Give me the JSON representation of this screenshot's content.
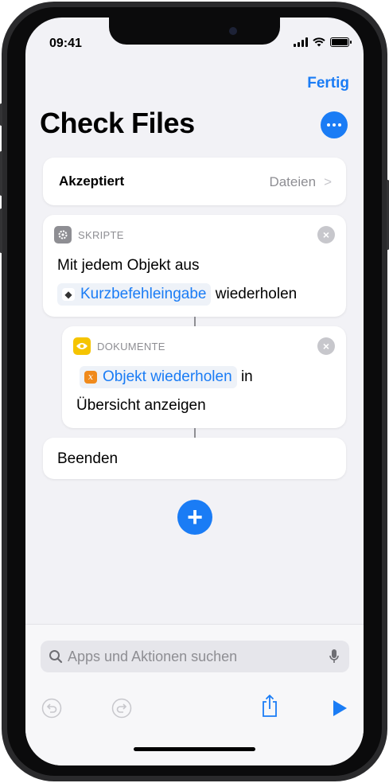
{
  "status": {
    "time": "09:41"
  },
  "nav": {
    "done_label": "Fertig"
  },
  "title": "Check Files",
  "accept": {
    "label": "Akzeptiert",
    "value": "Dateien"
  },
  "actions": [
    {
      "category": "SKRIPTE",
      "line1": "Mit jedem Objekt aus",
      "token": "Kurzbefehleingabe",
      "line2_suffix": "wiederholen"
    },
    {
      "category": "DOKUMENTE",
      "token": "Objekt wiederholen",
      "line1_suffix": "in",
      "line2": "Übersicht anzeigen"
    }
  ],
  "end": {
    "label": "Beenden"
  },
  "search": {
    "placeholder": "Apps und Aktionen suchen"
  },
  "icons": {
    "more": "more-icon",
    "scripts": "gear-icon",
    "documents": "eye-icon",
    "input": "shortcut-input-icon",
    "variable": "variable-icon",
    "search": "search-icon",
    "mic": "microphone-icon",
    "undo": "undo-icon",
    "redo": "redo-icon",
    "share": "share-icon",
    "play": "play-icon"
  },
  "colors": {
    "accent": "#1a7cf5",
    "scripts_icon": "#8e8e93",
    "documents_icon": "#f5c400",
    "variable_icon": "#f08a1c"
  }
}
